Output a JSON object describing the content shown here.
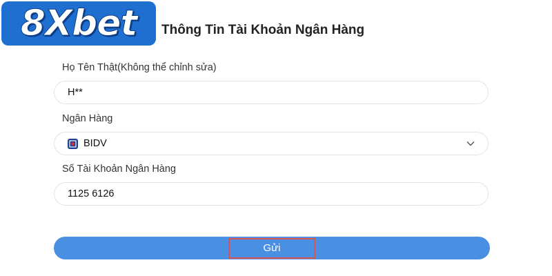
{
  "brand": {
    "logo_text": "8Xbet",
    "logo_color": "#1f6fd1"
  },
  "page": {
    "title": "Thông Tin Tài Khoản Ngân Hàng"
  },
  "form": {
    "full_name": {
      "label": "Họ Tên Thật(Không thể chỉnh sửa)",
      "value": "H**"
    },
    "bank": {
      "label": "Ngân Hàng",
      "selected": "BIDV",
      "icon": "bidv-bank-icon"
    },
    "account_number": {
      "label": "Số Tài Khoản Ngân Hàng",
      "value": "1125 6126"
    },
    "submit_label": "Gửi"
  },
  "colors": {
    "accent": "#4a90e2",
    "highlight_border": "#d9534f"
  }
}
